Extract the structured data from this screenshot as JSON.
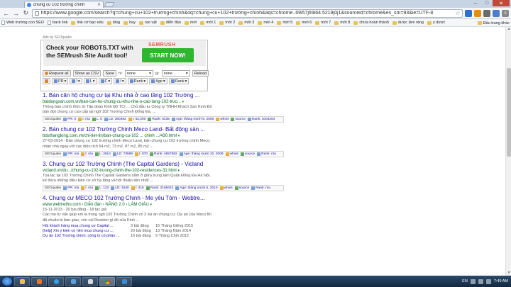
{
  "browser": {
    "tab_title": "chung cu 102 trường chính",
    "url": "https://www.google.com/search?q=chung+cu+102+trường+chính&oq=chung+cu+102+trường+chính&aqs=chrome..69i57j69i64.5219j0j1&sourceid=chrome&es_sm=93&ie=UTF-8"
  },
  "bookmarks": [
    "Web trường con SEO",
    "back link",
    "link cờ bạc edu",
    "blog",
    "hay",
    "rao vặt",
    "diễn đàn",
    "mới",
    "mới 1",
    "mới 2",
    "mới 3",
    "mới 4",
    "mới 5",
    "mới 6",
    "mới 7",
    "mới 8",
    "chưa hoàn thành",
    "dược làm rảng",
    "y dược"
  ],
  "bookmarks_right": "Đầu trang khác",
  "ad": {
    "label": "Ads by SEOquake",
    "headline_line1": "Check your ROBOTS.TXT with",
    "headline_line2": "the SEMrush Site Audit tool!",
    "logo": "SEMRUSH",
    "cta": "START NOW!"
  },
  "controls": {
    "request_all": "Request all",
    "show_csv": "Show as CSV",
    "save": "Save",
    "hl_label": "hl:",
    "hl_value": "none",
    "gl_label": "gl:",
    "gl_value": "none",
    "reload": "Reload"
  },
  "params": [
    {
      "label": "PR"
    },
    {
      "label": "I"
    },
    {
      "label": "L"
    },
    {
      "label": "C"
    },
    {
      "label": "I"
    },
    {
      "label": "Rank"
    },
    {
      "label": "Age"
    },
    {
      "label": "Rank"
    }
  ],
  "results": [
    {
      "num": "1.",
      "title": "Bán căn hộ chung cư tại Khu nhà ở cao tầng 102 Trường ...",
      "url": "batdongsan.com.vn/ban-can-ho-chung-cu-khu-nha-o-cao-tang-102-truo...",
      "snippet": "Thông báo chính thức từ Tập đoàn Kinh Đô TCI ... Chủ đầu tư Công ty TNHH Khách Sạn Kinh Đô bán đợt chung cư cao cấp tại ngõ 102 Trường Chinh Đống Đa, ...",
      "seo": [
        "SEOquake",
        "PR: 0",
        "I: n/a",
        "L: 0",
        "LD: 260482",
        "I: 52,200",
        "Rank: 6435",
        "Age: tháng mười 5, 2006",
        "whois",
        "source",
        "Rank: 1004264"
      ]
    },
    {
      "num": "2.",
      "title": "Bán chung cư 102 Trường Chinh Meco Land- Bất động sản ...",
      "url": "bdsthanglong.com.vn/chi-tiet-tin/ban-chung-cu-102 ... chinh .../430.html",
      "snippet": "27-03-2014 - Bán chung cư 102 trường chinh Meco Land, bán chung cư 102 trường chinh Meco, nhận nhà ngay với các diện tích 54 m2, 73 m2, 87 m2, 85 m2 ...",
      "seo": [
        "SEOquake",
        "PR: n/a",
        "I: n/a",
        "L: 2914",
        "LD: 73668",
        "I: 870",
        "Rank: 4557592",
        "Age: tháng mười 10, 2009",
        "whois",
        "source",
        "Rank: n/a"
      ]
    },
    {
      "num": "3.",
      "title": "Chung cư 102 Trường Chinh (The Capital Gardens) - Vicland",
      "url": "vicland.vn/du.../chung-cu-102-truong-chinh-the-102-residences-31.html",
      "snippet": "Tọa lạc tại 102 Trường Chinh The Capital Gardens nằm ở giữa trung tâm Quận Đống Đa Hà Nội, kế thừa những điều kiện cơ sở hạ tầng và hội thuận tiện nhất ...",
      "seo": [
        "SEOquake",
        "PR: n/a",
        "I: n/a",
        "L: 133",
        "LD: 3440",
        "I: 416",
        "Rank: 2158424",
        "Age: tháng mười 5, 2010",
        "whois",
        "source",
        "Rank: n/a"
      ]
    },
    {
      "num": "4.",
      "title": "Chung cư MECO 102 Trường Chinh - Me yêu Tôm - Webtre...",
      "url": "www.webtretho.com › Diễn đàn › NĂNG 2.0 › LÀM GIÀU",
      "date": "15-11-2013 - 20 bài đăng - 18 tác giả",
      "snippet": "Các mẹ tư vấn giúp em là trong ngõ 102 Trường Chinh có 2 dự án chung cư. Dự án của Meco thì đã chuẩn bị bàn giao, còn cái Residen gì đó của Kinh ...",
      "sitelinks": [
        {
          "a": "Hỏi khách hàng mua chung cư Capital ...",
          "b": "3 bài đăng",
          "c": "16 Tháng Giêng 2015"
        },
        {
          "a": "[help] Xin ý kiến có nên mua chung cư ...",
          "b": "20 bài đăng",
          "c": "13 Tháng Năm 2014"
        },
        {
          "a": "Dự án 102 Trường chinh, công ty cổ phần ...",
          "b": "16 bài đăng",
          "c": "9 Tháng Chín 2012"
        }
      ]
    }
  ],
  "taskbar": {
    "lang": "EN",
    "time": "7:49 AM"
  }
}
